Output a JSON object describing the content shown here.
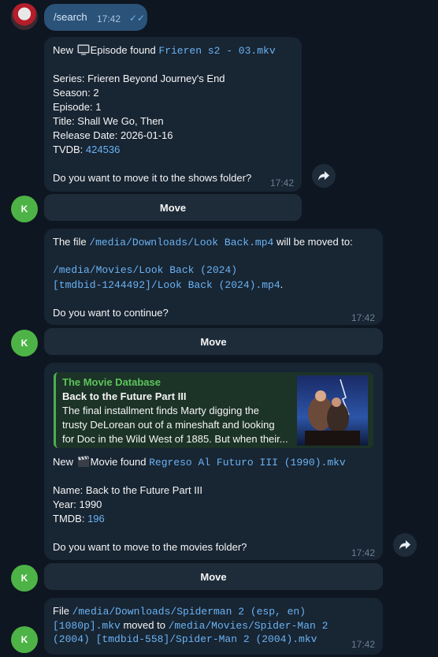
{
  "sent": {
    "text": "/search",
    "time": "17:42"
  },
  "bot_avatar_letter": "K",
  "msg1": {
    "prefix": "New",
    "kind": "Episode found",
    "file": "Frieren s2 - 03.mkv",
    "series": "Series: Frieren Beyond Journey's End",
    "season": "Season: 2",
    "episode": "Episode: 1",
    "title": "Title: Shall We Go, Then",
    "release": "Release Date: 2026-01-16",
    "tvdb_label": "TVDB:",
    "tvdb_id": "424536",
    "question": "Do you want to move it to the shows folder?",
    "time": "17:42",
    "button": "Move"
  },
  "msg2": {
    "intro": "The file",
    "src": "/media/Downloads/Look Back.mp4",
    "will": "will be moved to:",
    "dest1": "/media/Movies/Look Back (2024)",
    "dest2": "[tmdbid-1244492]/Look Back (2024).mp4",
    "dot": ".",
    "question": "Do you want to continue?",
    "time": "17:42",
    "button": "Move"
  },
  "msg3": {
    "preview": {
      "site": "The Movie Database",
      "title": "Back to the Future Part III",
      "desc1": "The final installment finds Marty digging the",
      "desc2": "trusty DeLorean out of a mineshaft and looking",
      "desc3": "for Doc in the Wild West of 1885. But when their..."
    },
    "prefix": "New",
    "kind": "Movie found",
    "file": "Regreso Al Futuro III (1990).mkv",
    "name": "Name: Back to the Future Part III",
    "year": "Year: 1990",
    "tmdb_label": "TMDB:",
    "tmdb_id": "196",
    "question": "Do you want to move to the movies folder?",
    "time": "17:42",
    "button": "Move"
  },
  "msg4": {
    "file_label": "File",
    "src1": "/media/Downloads/Spiderman 2 (esp, en)",
    "src2": "[1080p].mkv",
    "moved": "moved to",
    "dest1": "/media/Movies/Spider-Man 2",
    "dest2": "(2004) [tmdbid-558]/Spider-Man 2 (2004).mkv",
    "time": "17:42"
  },
  "colors": {
    "background": "#0e1621",
    "bubble": "#182533",
    "outgoing": "#2b5278",
    "link": "#6ab3f3",
    "bot_avatar": "#4db346"
  }
}
